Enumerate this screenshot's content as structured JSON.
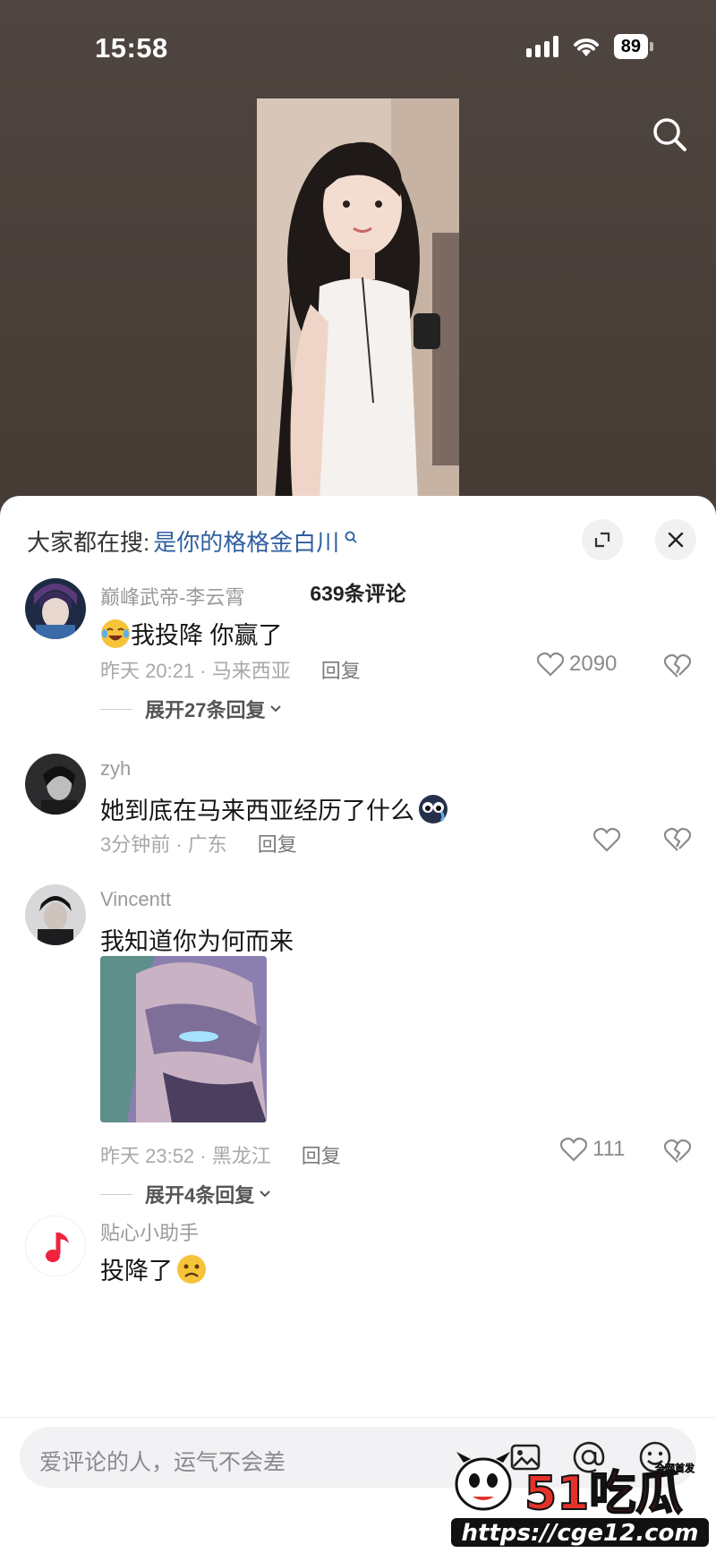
{
  "status": {
    "time": "15:58",
    "battery": "89"
  },
  "hot_search": {
    "prefix": "大家都在搜:",
    "query": "是你的格格金白川"
  },
  "comment_count_label": "639条评论",
  "comments": [
    {
      "user": "巅峰武帝-李云霄",
      "text": "我投降 你赢了",
      "time_location": "昨天 20:21 · 马来西亚",
      "reply": "回复",
      "likes": "2090",
      "expand": "展开27条回复"
    },
    {
      "user": "zyh",
      "text": "她到底在马来西亚经历了什么",
      "time_location": "3分钟前 · 广东",
      "reply": "回复"
    },
    {
      "user": "Vincentt",
      "text": "我知道你为何而来",
      "time_location": "昨天 23:52 · 黑龙江",
      "reply": "回复",
      "likes": "111",
      "expand": "展开4条回复"
    },
    {
      "user": "贴心小助手",
      "text": "投降了"
    }
  ],
  "input": {
    "placeholder": "爱评论的人，运气不会差"
  },
  "watermark": {
    "brand": "51吃瓜",
    "url": "https://cge12.com",
    "tag": "全网首发"
  },
  "colors": {
    "accent_link": "#2f5fa0",
    "sheet_bg": "#ffffff",
    "top_bg": "#4a403a"
  },
  "icons": [
    "search-icon",
    "expand-icon",
    "close-icon",
    "heart-icon",
    "broken-heart-icon",
    "chevron-down-icon",
    "image-icon",
    "at-icon",
    "smiley-icon"
  ]
}
